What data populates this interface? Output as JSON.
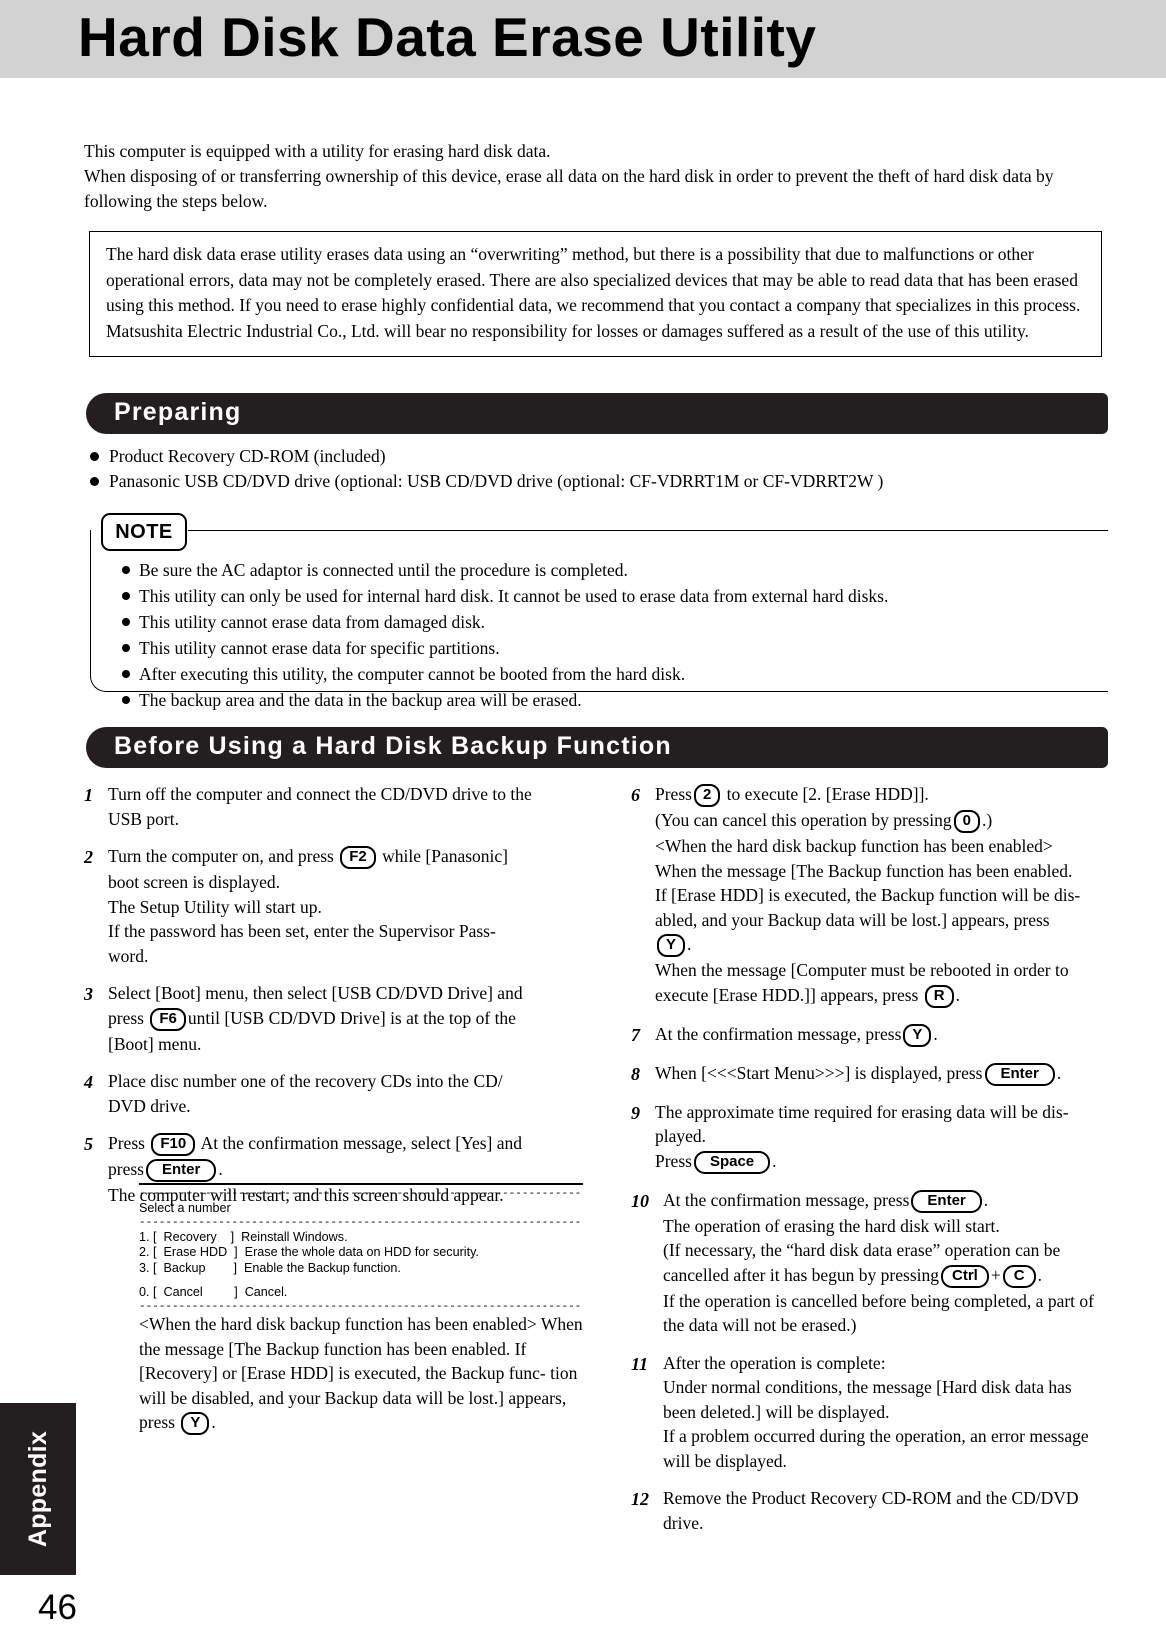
{
  "header": {
    "title": "Hard Disk Data Erase Utility"
  },
  "intro": {
    "line1": "This computer is equipped with a utility for erasing hard disk data.",
    "line2": "When disposing of or transferring ownership of this device, erase all data on the hard disk in order to prevent the theft of hard disk data by following the steps below."
  },
  "caution": {
    "text": "The hard disk data erase utility erases data using an “overwriting” method, but there is a possibility that due to malfunctions or other operational errors, data may not be completely erased. There are also specialized devices that may be able to read data that has been erased using this method. If you need to erase highly confidential data, we recommend that you contact a company that specializes in this process. Matsushita Electric Industrial Co., Ltd. will bear no responsibility for losses or damages suffered as a result of the use of this utility."
  },
  "sections": {
    "preparing": "Preparing",
    "before_using": "Before Using a Hard Disk Backup Function"
  },
  "preparing_items": [
    "Product Recovery CD-ROM (included)",
    "Panasonic USB CD/DVD drive (optional:  USB CD/DVD drive (optional:  CF-VDRRT1M or CF-VDRRT2W )"
  ],
  "note": {
    "tag": "NOTE",
    "items": [
      "Be sure the AC adaptor is connected until the procedure is completed.",
      "This utility can only be used for internal hard disk.  It cannot be used to erase data from external hard disks.",
      "This utility cannot erase data from damaged disk.",
      "This utility cannot erase data for specific partitions.",
      "After executing this utility, the computer cannot be booted from the hard disk.",
      "The backup area and the data in the backup area will be erased."
    ]
  },
  "steps_left": {
    "s1": {
      "num": "1",
      "l1": "Turn off the computer and connect the CD/DVD drive to the",
      "l2": "USB port."
    },
    "s2": {
      "num": "2",
      "l1a": "Turn the computer on, and press",
      "key": "F2",
      "l1b": "while [Panasonic]",
      "l2": "boot screen is displayed.",
      "l3": "The Setup Utility will start up.",
      "l4": "If the password has been set, enter the Supervisor Pass-",
      "l5": "word."
    },
    "s3": {
      "num": "3",
      "l1": "Select [Boot] menu, then select [USB CD/DVD Drive] and",
      "l2a": "press",
      "key": "F6",
      "l2b": "until [USB CD/DVD Drive] is at the top of the",
      "l3": "[Boot] menu."
    },
    "s4": {
      "num": "4",
      "l1": "Place disc number one of the recovery CDs into the CD/",
      "l2": "DVD drive."
    },
    "s5": {
      "num": "5",
      "l1a": "Press",
      "key1": "F10",
      "l1b": "At the confirmation message, select [Yes] and",
      "l2a": "press",
      "key2": "Enter",
      "l2b": ".",
      "l3": "The computer will restart, and this screen should appear."
    }
  },
  "console": {
    "rule": "-----------------------------------------------------------------------",
    "prompt": "Select a number",
    "rows": [
      "1. [  Recovery    ]  Reinstall Windows.",
      "2. [  Erase HDD  ]  Erase the whole data on HDD for security.",
      "3. [  Backup        ]  Enable the Backup function."
    ],
    "cancel_row": "0. [  Cancel         ]  Cancel."
  },
  "post_console": {
    "l1": "<When the hard disk backup function has been enabled>",
    "l2": "When the message [The Backup function has been enabled.",
    "l3": "If [Recovery] or [Erase HDD] is executed, the Backup func-",
    "l4": "tion will be disabled, and your Backup data will be lost.]",
    "l5a": "appears, press",
    "key": "Y",
    "l5b": "."
  },
  "steps_right": {
    "s6": {
      "num": "6",
      "l1a": "Press",
      "key1": "2",
      "l1b": "to execute [2. [Erase HDD]].",
      "l2a": "(You can cancel this operation by pressing",
      "key2": "0",
      "l2b": ".)",
      "l3": "<When the hard disk backup function has been enabled>",
      "l4": "When the message [The Backup function has been enabled.",
      "l5": "If [Erase HDD] is executed, the Backup function will be dis-",
      "l6": "abled, and your Backup data will be lost.] appears, press",
      "key3": "Y",
      "l7": ".",
      "l8": "When the message [Computer must be rebooted in order to",
      "l9a": "execute [Erase HDD.]] appears, press",
      "key4": "R",
      "l9b": "."
    },
    "s7": {
      "num": "7",
      "l1a": "At the confirmation message, press",
      "key": "Y",
      "l1b": "."
    },
    "s8": {
      "num": "8",
      "l1a": "When [<<<Start Menu>>>] is displayed, press",
      "key": "Enter",
      "l1b": "."
    },
    "s9": {
      "num": "9",
      "l1": "The approximate time required for erasing data will be dis-",
      "l2": "played.",
      "l3a": "Press",
      "key": "Space",
      "l3b": "."
    },
    "s10": {
      "num": "10",
      "l1a": "At the confirmation message, press",
      "key1": "Enter",
      "l1b": ".",
      "l2": "The operation of erasing the hard disk will start.",
      "l3": "(If necessary, the “hard disk data erase” operation can be",
      "l4a": "cancelled after it has begun by pressing",
      "key2": "Ctrl",
      "plus": "+",
      "key3": "C",
      "l4b": ".",
      "l5": "If the operation is cancelled before being completed, a part of",
      "l6": "the data will not be erased.)"
    },
    "s11": {
      "num": "11",
      "l1": "After the operation is complete:",
      "l2": "Under normal conditions, the message [Hard disk data has",
      "l3": "been deleted.] will be displayed.",
      "l4": "If a problem occurred during the operation, an error message",
      "l5": "will be displayed."
    },
    "s12": {
      "num": "12",
      "l1": "Remove the Product Recovery CD-ROM and the CD/DVD",
      "l2": "drive."
    }
  },
  "footer": {
    "tab_label": "Appendix",
    "page_number": "46"
  }
}
